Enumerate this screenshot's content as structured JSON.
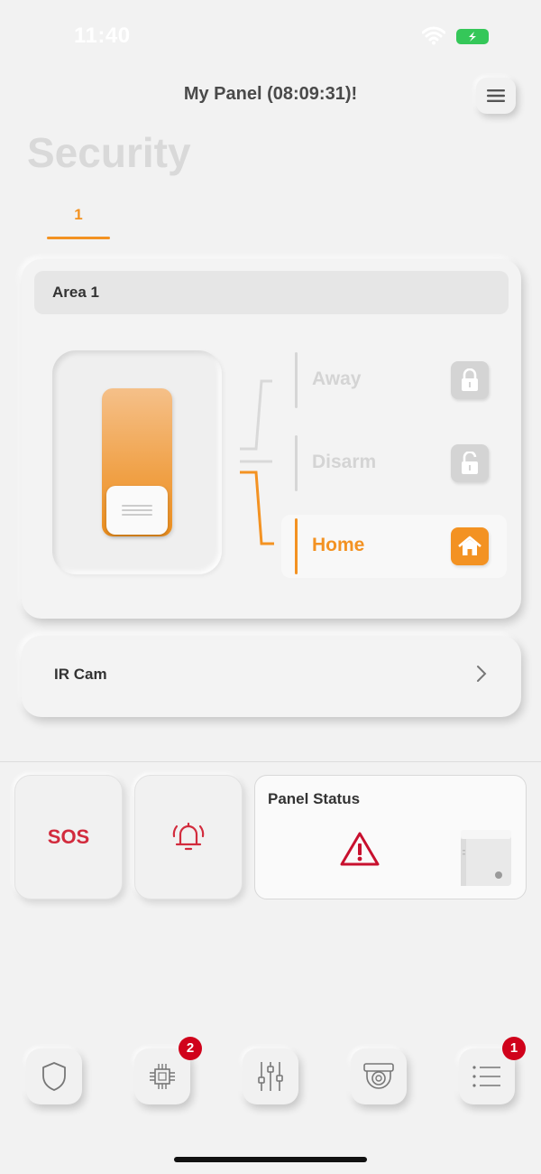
{
  "status_bar": {
    "time": "11:40"
  },
  "header": {
    "title": "My Panel (08:09:31)!",
    "menu_icon": "hamburger-icon"
  },
  "page": {
    "title": "Security"
  },
  "tabs": [
    {
      "label": "1",
      "active": true
    }
  ],
  "area": {
    "name": "Area 1",
    "modes": [
      {
        "label": "Away",
        "icon": "lock-closed-icon",
        "active": false
      },
      {
        "label": "Disarm",
        "icon": "lock-open-icon",
        "active": false
      },
      {
        "label": "Home",
        "icon": "home-icon",
        "active": true
      }
    ]
  },
  "ir_cam": {
    "label": "IR Cam"
  },
  "quick_actions": {
    "sos_label": "SOS",
    "alarm_icon": "bell-ringing-icon",
    "panel_status_title": "Panel Status",
    "panel_status_icon": "warning-icon"
  },
  "bottom_nav": [
    {
      "icon": "shield-icon",
      "badge": null
    },
    {
      "icon": "chip-icon",
      "badge": "2"
    },
    {
      "icon": "sliders-icon",
      "badge": null
    },
    {
      "icon": "camera-icon",
      "badge": null
    },
    {
      "icon": "list-icon",
      "badge": "1"
    }
  ],
  "colors": {
    "accent": "#f39222",
    "danger": "#d22b3d",
    "badge": "#d0021b",
    "inactive": "#d4d4d4"
  }
}
